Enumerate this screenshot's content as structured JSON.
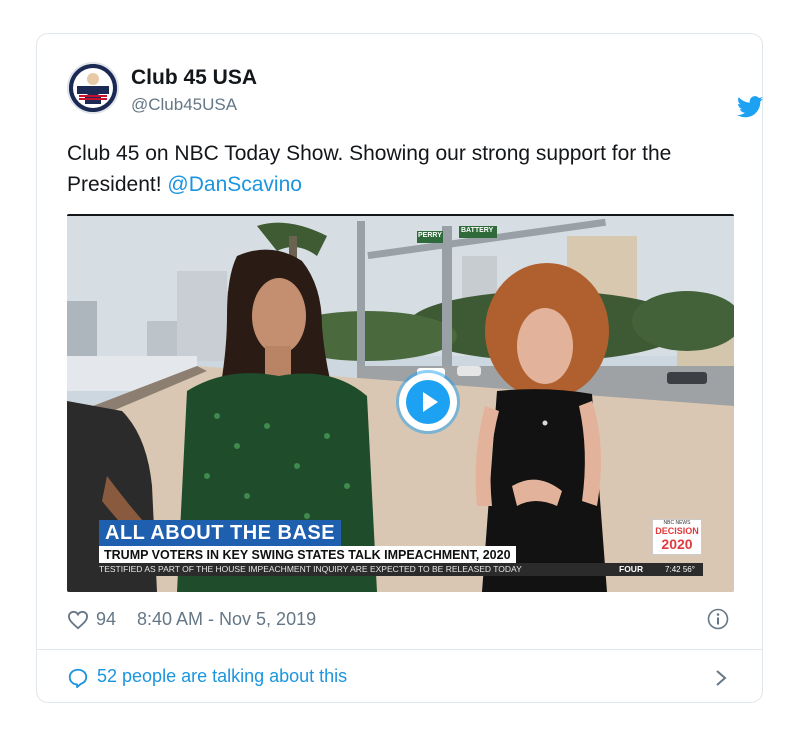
{
  "tweet": {
    "display_name": "Club 45 USA",
    "handle": "@Club45USA",
    "text": "Club 45 on NBC Today Show. Showing our strong support for the President!",
    "mention": "@DanScavino",
    "likes": "94",
    "timestamp": "8:40 AM - Nov 5, 2019",
    "talking": "52 people are talking about this"
  },
  "video": {
    "lower_third_title": "ALL ABOUT THE BASE",
    "lower_third_subtitle": "TRUMP VOTERS IN KEY SWING STATES TALK IMPEACHMENT, 2020",
    "ticker": "TESTIFIED AS PART OF THE HOUSE IMPEACHMENT INQUIRY ARE EXPECTED TO BE RELEASED TODAY",
    "ticker_right": "FOUR",
    "clock": "7:42  56°",
    "badge_top": "NBC NEWS",
    "badge_line1": "DECISION",
    "badge_line2": "2020",
    "street_sign_1": "PERRY",
    "street_sign_2": "BATTERY"
  },
  "colors": {
    "accent": "#1b95e0",
    "text": "#14171a",
    "muted": "#657786",
    "border": "#e1e8ed"
  },
  "icons": [
    "twitter-bird-icon",
    "heart-icon",
    "info-icon",
    "speech-bubble-icon",
    "chevron-right-icon",
    "play-icon"
  ]
}
